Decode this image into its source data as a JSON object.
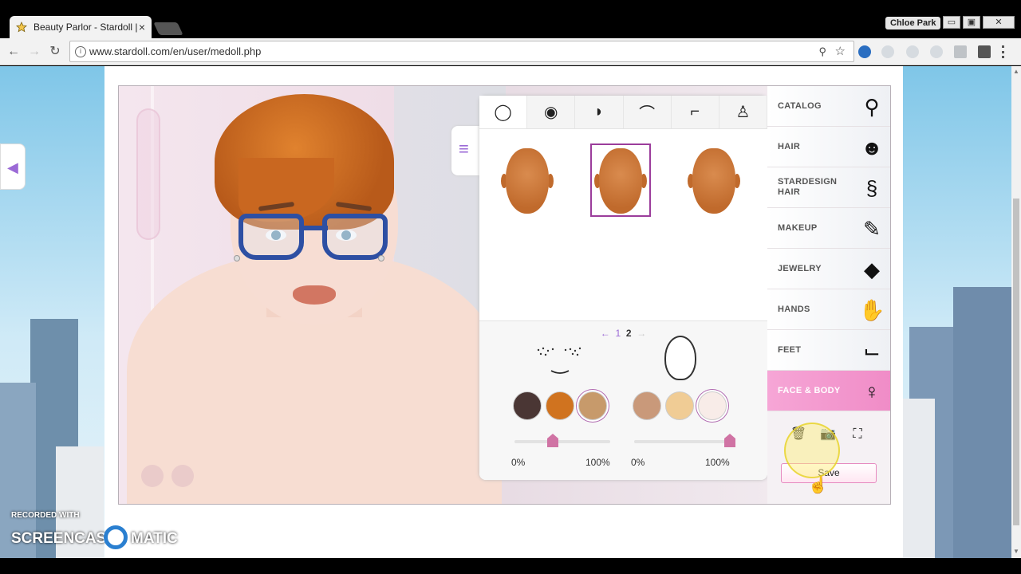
{
  "browser": {
    "tab_title": "Beauty Parlor - Stardoll |",
    "tab_close": "×",
    "profile_name": "Chloe Park",
    "window_controls": {
      "minimize": "▭",
      "maximize": "▣",
      "close": "✕"
    },
    "nav": {
      "back": "←",
      "forward": "→",
      "reload": "↻"
    },
    "url": "www.stardoll.com/en/user/medoll.php",
    "page_icon": "i",
    "zoom_icon": "⚲",
    "star_icon": "☆"
  },
  "editor": {
    "menu_icon": "≡",
    "side_icon": "◀",
    "feature_tabs": [
      {
        "name": "face-shape",
        "icon": "◯"
      },
      {
        "name": "eyes",
        "icon": "◉"
      },
      {
        "name": "lips",
        "icon": "◗"
      },
      {
        "name": "eyebrows",
        "icon": "⌒"
      },
      {
        "name": "nose",
        "icon": "⌐"
      },
      {
        "name": "body",
        "icon": "♙"
      }
    ],
    "pager": {
      "prev": "←",
      "page1": "1",
      "page2": "2",
      "next": "→"
    },
    "freckle_swatches": [
      "#4a3634",
      "#d0731f",
      "#c79a6b"
    ],
    "body_swatches": [
      "#c9997a",
      "#f0cc95",
      "#f8ece8"
    ],
    "slider_left": {
      "value_percent": 40,
      "min_label": "0%",
      "max_label": "100%"
    },
    "slider_right": {
      "value_percent": 100,
      "min_label": "0%",
      "max_label": "100%"
    }
  },
  "categories": [
    {
      "label": "CATALOG",
      "icon": "⚲"
    },
    {
      "label": "HAIR",
      "icon": "☻"
    },
    {
      "label": "STARDESIGN HAIR",
      "icon": "§"
    },
    {
      "label": "MAKEUP",
      "icon": "✎"
    },
    {
      "label": "JEWELRY",
      "icon": "◆"
    },
    {
      "label": "HANDS",
      "icon": "✋"
    },
    {
      "label": "FEET",
      "icon": "⌙"
    },
    {
      "label": "FACE & BODY",
      "icon": "♀"
    }
  ],
  "tools": {
    "trash": "🗑",
    "camera": "📷",
    "fullscreen": "⛶"
  },
  "save_label": "Save",
  "watermark": {
    "recorded": "RECORDED WITH",
    "brand_left": "SCREENCAST",
    "brand_right": "MATIC"
  }
}
